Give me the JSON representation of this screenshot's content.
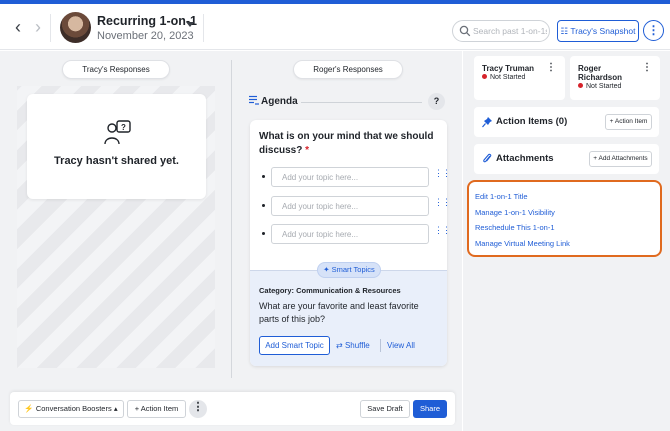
{
  "header": {
    "title": "Recurring 1-on-1",
    "date": "November 20, 2023",
    "search_placeholder": "Search past 1-on-1s",
    "snapshot_label": "Tracy's Snapshot"
  },
  "tabs": {
    "left": "Tracy's Responses",
    "right": "Roger's Responses"
  },
  "empty_state": {
    "message": "Tracy hasn't shared yet."
  },
  "agenda": {
    "title": "Agenda",
    "question": "What is on your mind that we should discuss?",
    "required_marker": "*",
    "topic_placeholder": "Add your topic here...",
    "smart_topics_label": "Smart Topics",
    "category": "Category: Communication & Resources",
    "smart_question": "What are your favorite and least favorite parts of this job?",
    "add_smart_topic": "Add Smart Topic",
    "shuffle": "Shuffle",
    "view_all": "View All"
  },
  "footer": {
    "conversation_boosters": "Conversation Boosters",
    "action_item": "+ Action Item",
    "save_draft": "Save Draft",
    "share": "Share"
  },
  "participants": [
    {
      "name": "Tracy Truman",
      "status": "Not Started"
    },
    {
      "name": "Roger Richardson",
      "status": "Not Started"
    }
  ],
  "action_items": {
    "title": "Action Items (0)",
    "button": "+ Action Item"
  },
  "attachments": {
    "title": "Attachments",
    "button": "+ Add Attachments"
  },
  "menu_links": [
    "Edit 1-on-1 Title",
    "Manage 1-on-1 Visibility",
    "Reschedule This 1-on-1",
    "Manage Virtual Meeting Link"
  ],
  "colors": {
    "accent": "#1f5dd6",
    "highlight_border": "#e06a1f",
    "status_not_started": "#d6232b"
  }
}
